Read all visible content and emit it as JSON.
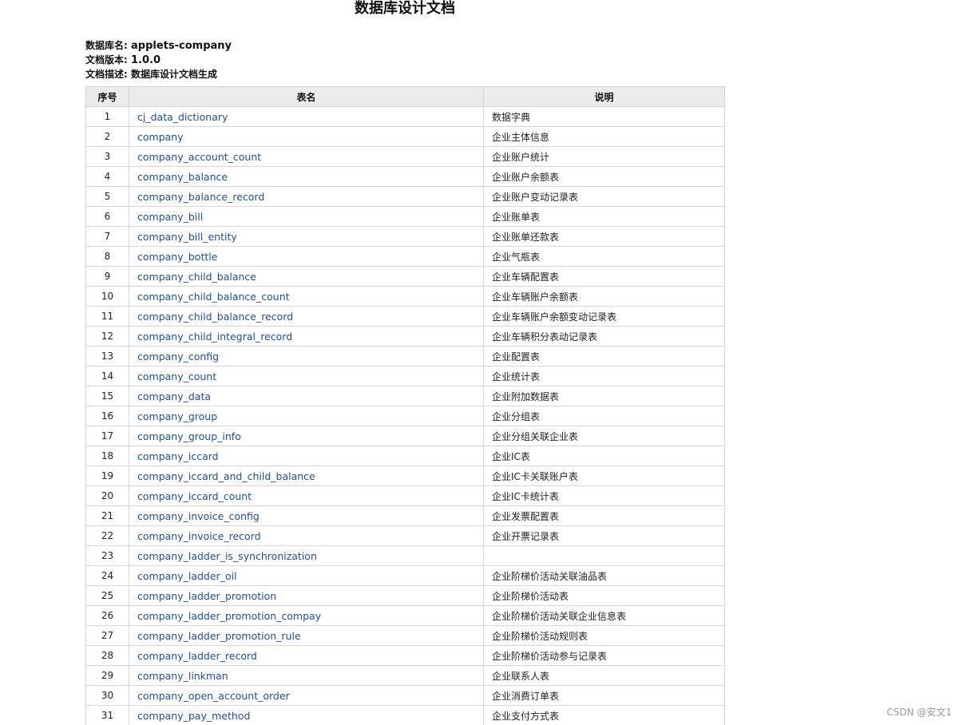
{
  "doc": {
    "title": "数据库设计文档",
    "db_name_label": "数据库名:",
    "db_name": "applets-company",
    "version_label": "文档版本:",
    "version": "1.0.0",
    "desc_label": "文档描述:",
    "desc": "数据库设计文档生成"
  },
  "table": {
    "headers": [
      "序号",
      "表名",
      "说明"
    ],
    "rows": [
      {
        "no": "1",
        "name": "cj_data_dictionary",
        "desc": "数据字典"
      },
      {
        "no": "2",
        "name": "company",
        "desc": "企业主体信息"
      },
      {
        "no": "3",
        "name": "company_account_count",
        "desc": "企业账户统计"
      },
      {
        "no": "4",
        "name": "company_balance",
        "desc": "企业账户余额表"
      },
      {
        "no": "5",
        "name": "company_balance_record",
        "desc": "企业账户变动记录表"
      },
      {
        "no": "6",
        "name": "company_bill",
        "desc": "企业账单表"
      },
      {
        "no": "7",
        "name": "company_bill_entity",
        "desc": "企业账单还款表"
      },
      {
        "no": "8",
        "name": "company_bottle",
        "desc": "企业气瓶表"
      },
      {
        "no": "9",
        "name": "company_child_balance",
        "desc": "企业车辆配置表"
      },
      {
        "no": "10",
        "name": "company_child_balance_count",
        "desc": "企业车辆账户余额表"
      },
      {
        "no": "11",
        "name": "company_child_balance_record",
        "desc": "企业车辆账户余额变动记录表"
      },
      {
        "no": "12",
        "name": "company_child_integral_record",
        "desc": "企业车辆积分表动记录表"
      },
      {
        "no": "13",
        "name": "company_config",
        "desc": "企业配置表"
      },
      {
        "no": "14",
        "name": "company_count",
        "desc": "企业统计表"
      },
      {
        "no": "15",
        "name": "company_data",
        "desc": "企业附加数据表"
      },
      {
        "no": "16",
        "name": "company_group",
        "desc": "企业分组表"
      },
      {
        "no": "17",
        "name": "company_group_info",
        "desc": "企业分组关联企业表"
      },
      {
        "no": "18",
        "name": "company_iccard",
        "desc": "企业IC表"
      },
      {
        "no": "19",
        "name": "company_iccard_and_child_balance",
        "desc": "企业IC卡关联账户表"
      },
      {
        "no": "20",
        "name": "company_iccard_count",
        "desc": "企业IC卡统计表"
      },
      {
        "no": "21",
        "name": "company_invoice_config",
        "desc": "企业发票配置表"
      },
      {
        "no": "22",
        "name": "company_invoice_record",
        "desc": "企业开票记录表"
      },
      {
        "no": "23",
        "name": "company_ladder_is_synchronization",
        "desc": ""
      },
      {
        "no": "24",
        "name": "company_ladder_oil",
        "desc": "企业阶梯价活动关联油品表"
      },
      {
        "no": "25",
        "name": "company_ladder_promotion",
        "desc": "企业阶梯价活动表"
      },
      {
        "no": "26",
        "name": "company_ladder_promotion_compay",
        "desc": "企业阶梯价活动关联企业信息表"
      },
      {
        "no": "27",
        "name": "company_ladder_promotion_rule",
        "desc": "企业阶梯价活动规则表"
      },
      {
        "no": "28",
        "name": "company_ladder_record",
        "desc": "企业阶梯价活动参与记录表"
      },
      {
        "no": "29",
        "name": "company_linkman",
        "desc": "企业联系人表"
      },
      {
        "no": "30",
        "name": "company_open_account_order",
        "desc": "企业消费订单表"
      },
      {
        "no": "31",
        "name": "company_pay_method",
        "desc": "企业支付方式表"
      }
    ]
  },
  "watermark": "CSDN @安文1"
}
